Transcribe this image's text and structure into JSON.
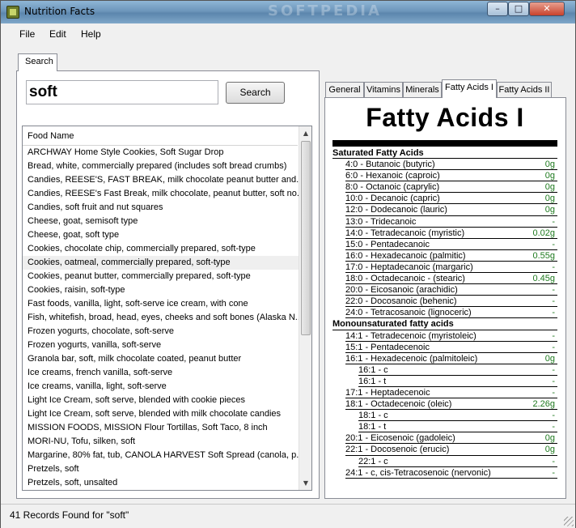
{
  "window": {
    "title": "Nutrition Facts",
    "watermark": "SOFTPEDIA",
    "controls": {
      "minimize": "–",
      "maximize": "□",
      "close": "✕"
    }
  },
  "menu": [
    "File",
    "Edit",
    "Help"
  ],
  "search": {
    "tab_label": "Search",
    "query": "soft",
    "button_label": "Search"
  },
  "list": {
    "column_header": "Food Name",
    "selected_index": 8,
    "rows": [
      "ARCHWAY Home Style Cookies, Soft Sugar Drop",
      "Bread, white, commercially prepared (includes soft bread crumbs)",
      "Candies, REESE'S, FAST BREAK, milk chocolate peanut butter and...",
      "Candies, REESE's Fast Break, milk chocolate, peanut butter, soft no...",
      "Candies, soft fruit and nut squares",
      "Cheese, goat, semisoft type",
      "Cheese, goat, soft type",
      "Cookies, chocolate chip, commercially prepared, soft-type",
      "Cookies, oatmeal, commercially prepared, soft-type",
      "Cookies, peanut butter, commercially prepared, soft-type",
      "Cookies, raisin, soft-type",
      "Fast foods, vanilla, light, soft-serve ice cream, with cone",
      "Fish, whitefish, broad, head, eyes, cheeks and soft bones (Alaska N...",
      "Frozen yogurts, chocolate, soft-serve",
      "Frozen yogurts, vanilla, soft-serve",
      "Granola bar, soft, milk chocolate coated, peanut butter",
      "Ice creams, french vanilla, soft-serve",
      "Ice creams, vanilla, light, soft-serve",
      "Light Ice Cream, soft serve, blended with cookie pieces",
      "Light Ice Cream, soft serve, blended with milk chocolate candies",
      "MISSION FOODS, MISSION Flour Tortillas, Soft Taco, 8 inch",
      "MORI-NU, Tofu, silken, soft",
      "Margarine, 80% fat, tub, CANOLA HARVEST Soft Spread (canola, p...",
      "Pretzels, soft",
      "Pretzels, soft, unsalted"
    ]
  },
  "detail_tabs": [
    {
      "label": "General",
      "active": false
    },
    {
      "label": "Vitamins",
      "active": false
    },
    {
      "label": "Minerals",
      "active": false
    },
    {
      "label": "Fatty Acids I",
      "active": true
    },
    {
      "label": "Fatty Acids II",
      "active": false
    }
  ],
  "fatty_acids": {
    "title": "Fatty Acids I",
    "rows": [
      {
        "label": "Saturated Fatty Acids",
        "value": "",
        "level": 0,
        "section": true
      },
      {
        "label": "4:0 - Butanoic (butyric)",
        "value": "0g",
        "level": 1
      },
      {
        "label": "6:0 - Hexanoic (caproic)",
        "value": "0g",
        "level": 1
      },
      {
        "label": "8:0 - Octanoic (caprylic)",
        "value": "0g",
        "level": 1
      },
      {
        "label": "10:0 - Decanoic (capric)",
        "value": "0g",
        "level": 1
      },
      {
        "label": "12:0 - Dodecanoic (lauric)",
        "value": "0g",
        "level": 1
      },
      {
        "label": "13:0 - Tridecanoic",
        "value": "-",
        "level": 1
      },
      {
        "label": "14:0 - Tetradecanoic (myristic)",
        "value": "0.02g",
        "level": 1
      },
      {
        "label": "15:0 - Pentadecanoic",
        "value": "-",
        "level": 1
      },
      {
        "label": "16:0 - Hexadecanoic (palmitic)",
        "value": "0.55g",
        "level": 1
      },
      {
        "label": "17:0 - Heptadecanoic (margaric)",
        "value": "-",
        "level": 1
      },
      {
        "label": "18:0 - Octadecanoic - (stearic)",
        "value": "0.45g",
        "level": 1
      },
      {
        "label": "20:0 - Eicosanoic (arachidic)",
        "value": "-",
        "level": 1
      },
      {
        "label": "22:0 - Docosanoic (behenic)",
        "value": "-",
        "level": 1
      },
      {
        "label": "24:0 - Tetracosanoic (lignoceric)",
        "value": "-",
        "level": 1
      },
      {
        "label": "Monounsaturated fatty acids",
        "value": "",
        "level": 0,
        "section": true
      },
      {
        "label": "14:1 - Tetradecenoic (myristoleic)",
        "value": "-",
        "level": 1
      },
      {
        "label": "15:1 - Pentadecenoic",
        "value": "-",
        "level": 1
      },
      {
        "label": "16:1 - Hexadecenoic (palmitoleic)",
        "value": "0g",
        "level": 1
      },
      {
        "label": "16:1 - c",
        "value": "-",
        "level": 2
      },
      {
        "label": "16:1 - t",
        "value": "-",
        "level": 2
      },
      {
        "label": "17:1 - Heptadecenoic",
        "value": "-",
        "level": 1
      },
      {
        "label": "18:1 - Octadecenoic (oleic)",
        "value": "2.26g",
        "level": 1
      },
      {
        "label": "18:1 - c",
        "value": "-",
        "level": 2
      },
      {
        "label": "18:1 - t",
        "value": "-",
        "level": 2
      },
      {
        "label": "20:1 - Eicosenoic (gadoleic)",
        "value": "0g",
        "level": 1
      },
      {
        "label": "22:1 - Docosenoic (erucic)",
        "value": "0g",
        "level": 1
      },
      {
        "label": "22:1 - c",
        "value": "-",
        "level": 2
      },
      {
        "label": "24:1 - c, cis-Tetracosenoic (nervonic)",
        "value": "-",
        "level": 1
      }
    ]
  },
  "status": {
    "text": "41 Records Found  for \"soft\""
  },
  "colors": {
    "value_green": "#1f7a1f",
    "selected_row": "#efefef",
    "title_bar": "#6d96bb"
  },
  "icons": [
    "app-icon",
    "scroll-up-icon",
    "scroll-down-icon",
    "size-grip-icon"
  ]
}
